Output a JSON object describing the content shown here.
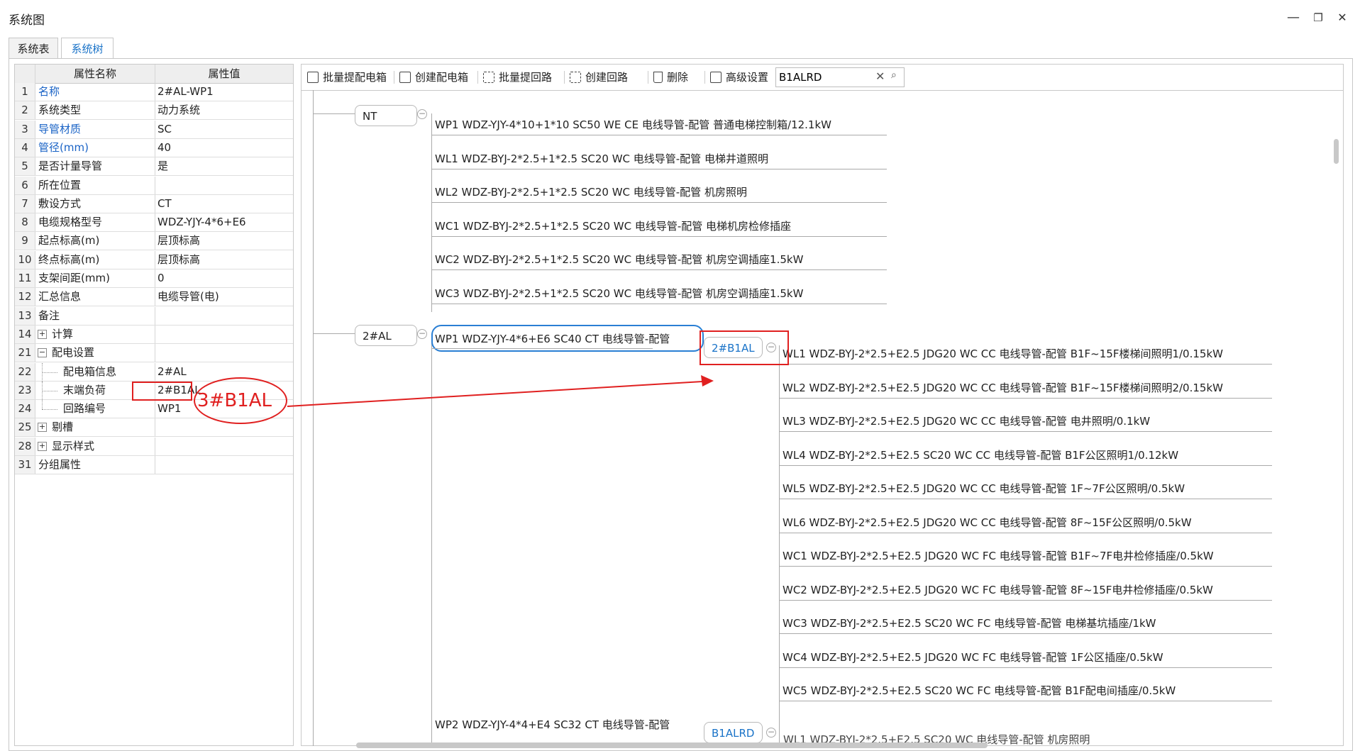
{
  "window": {
    "title": "系统图",
    "minimize": "—",
    "restore": "❐",
    "close": "✕"
  },
  "tabs": [
    {
      "label": "系统表"
    },
    {
      "label": "系统树"
    }
  ],
  "grid": {
    "headers": {
      "name": "属性名称",
      "value": "属性值"
    },
    "rows": [
      {
        "num": "1",
        "name": "名称",
        "value": "2#AL-WP1"
      },
      {
        "num": "2",
        "name": "系统类型",
        "value": "动力系统"
      },
      {
        "num": "3",
        "name": "导管材质",
        "value": "SC"
      },
      {
        "num": "4",
        "name": "管径(mm)",
        "value": "40"
      },
      {
        "num": "5",
        "name": "是否计量导管",
        "value": "是"
      },
      {
        "num": "6",
        "name": "所在位置",
        "value": ""
      },
      {
        "num": "7",
        "name": "敷设方式",
        "value": "CT"
      },
      {
        "num": "8",
        "name": "电缆规格型号",
        "value": "WDZ-YJY-4*6+E6"
      },
      {
        "num": "9",
        "name": "起点标高(m)",
        "value": "层顶标高"
      },
      {
        "num": "10",
        "name": "终点标高(m)",
        "value": "层顶标高"
      },
      {
        "num": "11",
        "name": "支架间距(mm)",
        "value": "0"
      },
      {
        "num": "12",
        "name": "汇总信息",
        "value": "电缆导管(电)"
      },
      {
        "num": "13",
        "name": "备注",
        "value": ""
      },
      {
        "num": "14",
        "name": "计算",
        "value": ""
      },
      {
        "num": "21",
        "name": "配电设置",
        "value": ""
      },
      {
        "num": "22",
        "name": "配电箱信息",
        "value": "2#AL"
      },
      {
        "num": "23",
        "name": "末端负荷",
        "value": "2#B1AL"
      },
      {
        "num": "24",
        "name": "回路编号",
        "value": "WP1"
      },
      {
        "num": "25",
        "name": "剔槽",
        "value": ""
      },
      {
        "num": "28",
        "name": "显示样式",
        "value": ""
      },
      {
        "num": "31",
        "name": "分组属性",
        "value": ""
      }
    ],
    "expand_plus": "+",
    "expand_minus": "−"
  },
  "toolbar": {
    "batch_extract_box": "批量提配电箱",
    "create_box": "创建配电箱",
    "batch_extract_circuit": "批量提回路",
    "create_circuit": "创建回路",
    "delete": "删除",
    "advanced": "高级设置",
    "search_value": "B1ALRD",
    "clear_icon": "✕",
    "search_icon": "⌕"
  },
  "tree": {
    "collapse_glyph": "−",
    "nt": {
      "label": "NT",
      "circuits": [
        "WP1 WDZ-YJY-4*10+1*10 SC50 WE CE 电线导管-配管 普通电梯控制箱/12.1kW",
        "WL1 WDZ-BYJ-2*2.5+1*2.5 SC20 WC 电线导管-配管 电梯井道照明",
        "WL2 WDZ-BYJ-2*2.5+1*2.5 SC20 WC 电线导管-配管 机房照明",
        "WC1 WDZ-BYJ-2*2.5+1*2.5 SC20 WC 电线导管-配管 电梯机房检修插座",
        "WC2 WDZ-BYJ-2*2.5+1*2.5 SC20 WC 电线导管-配管 机房空调插座1.5kW",
        "WC3 WDZ-BYJ-2*2.5+1*2.5 SC20 WC 电线导管-配管 机房空调插座1.5kW"
      ]
    },
    "al2": {
      "label": "2#AL",
      "wp1": "WP1 WDZ-YJY-4*6+E6 SC40 CT 电线导管-配管",
      "b1al": {
        "label": "2#B1AL",
        "circuits": [
          "WL1 WDZ-BYJ-2*2.5+E2.5 JDG20 WC CC 电线导管-配管 B1F~15F楼梯间照明1/0.15kW",
          "WL2 WDZ-BYJ-2*2.5+E2.5 JDG20 WC CC 电线导管-配管 B1F~15F楼梯间照明2/0.15kW",
          "WL3 WDZ-BYJ-2*2.5+E2.5 JDG20 WC CC 电线导管-配管 电井照明/0.1kW",
          "WL4 WDZ-BYJ-2*2.5+E2.5 SC20 WC CC 电线导管-配管 B1F公区照明1/0.12kW",
          "WL5 WDZ-BYJ-2*2.5+E2.5 JDG20 WC CC 电线导管-配管 1F~7F公区照明/0.5kW",
          "WL6 WDZ-BYJ-2*2.5+E2.5 JDG20 WC CC 电线导管-配管 8F~15F公区照明/0.5kW",
          "WC1 WDZ-BYJ-2*2.5+E2.5 JDG20 WC FC 电线导管-配管 B1F~7F电井检修插座/0.5kW",
          "WC2 WDZ-BYJ-2*2.5+E2.5 JDG20 WC FC 电线导管-配管 8F~15F电井检修插座/0.5kW",
          "WC3 WDZ-BYJ-2*2.5+E2.5 SC20 WC FC 电线导管-配管 电梯基坑插座/1kW",
          "WC4 WDZ-BYJ-2*2.5+E2.5 JDG20 WC FC 电线导管-配管 1F公区插座/0.5kW",
          "WC5 WDZ-BYJ-2*2.5+E2.5 SC20 WC FC 电线导管-配管 B1F配电间插座/0.5kW"
        ]
      },
      "wp2": "WP2 WDZ-YJY-4*4+E4 SC32 CT 电线导管-配管",
      "b1alrd": {
        "label": "B1ALRD",
        "partial": "WL1 WDZ-BYJ-2*2.5+E2.5 SC20 WC 电线导管-配管 机房照明"
      }
    }
  },
  "annotation": {
    "text": "3#B1AL",
    "color": "#e02020"
  }
}
